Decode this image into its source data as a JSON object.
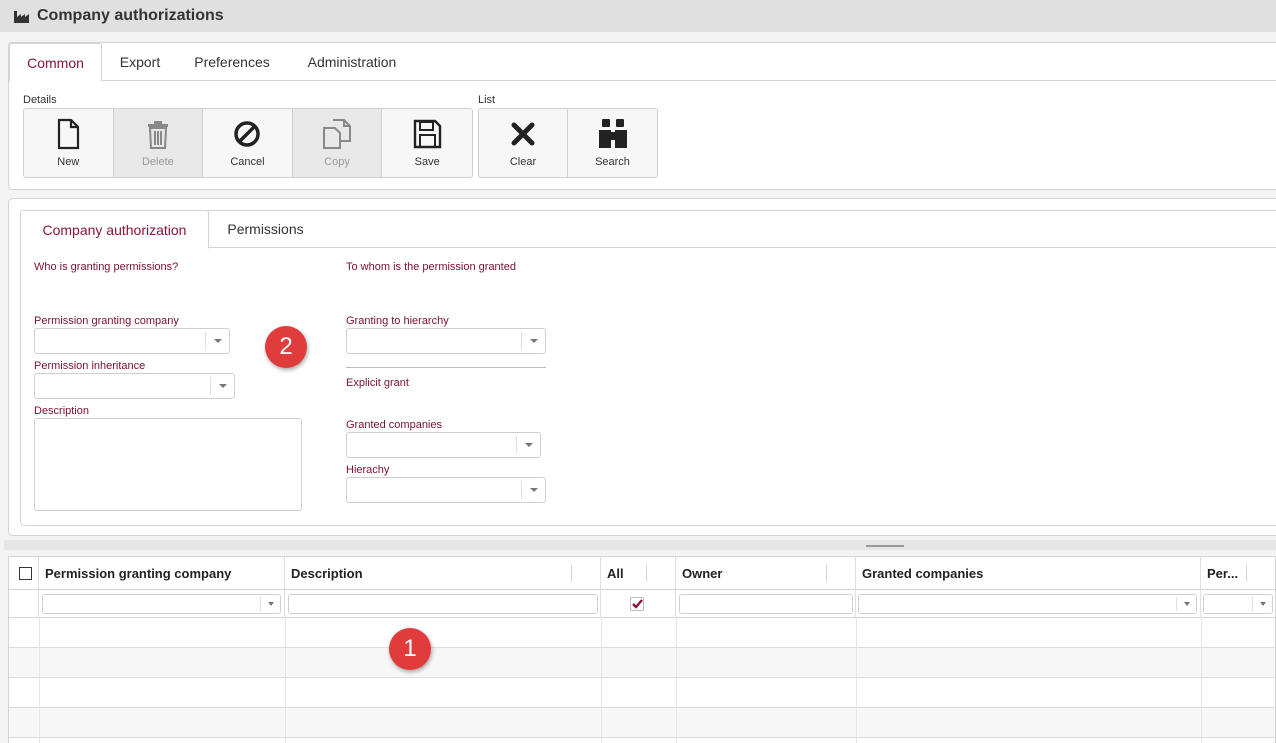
{
  "window": {
    "title": "Company authorizations",
    "icon": "factory-icon"
  },
  "main_tabs": [
    {
      "label": "Common",
      "active": true
    },
    {
      "label": "Export",
      "active": false
    },
    {
      "label": "Preferences",
      "active": false
    },
    {
      "label": "Administration",
      "active": false
    }
  ],
  "toolbar": {
    "details_label": "Details",
    "list_label": "List",
    "new": "New",
    "delete": "Delete",
    "cancel": "Cancel",
    "copy": "Copy",
    "save": "Save",
    "clear": "Clear",
    "search": "Search"
  },
  "form_tabs": [
    {
      "label": "Company authorization",
      "active": true
    },
    {
      "label": "Permissions",
      "active": false
    }
  ],
  "form": {
    "left_heading": "Who is granting permissions?",
    "right_heading": "To whom is the permission granted",
    "granting_company_label": "Permission granting company",
    "inheritance_label": "Permission inheritance",
    "description_label": "Description",
    "granting_hierarchy_label": "Granting to hierarchy",
    "explicit_grant_label": "Explicit grant",
    "granted_companies_label": "Granted companies",
    "hierarchy_label": "Hierachy"
  },
  "badges": {
    "one": "1",
    "two": "2"
  },
  "grid": {
    "columns": {
      "granting_company": "Permission granting company",
      "description": "Description",
      "all": "All",
      "owner": "Owner",
      "granted_companies": "Granted companies",
      "per": "Per..."
    },
    "all_filter_checked": true,
    "rows": 4
  },
  "colors": {
    "accent": "#8a1538",
    "badge": "#e03c3c"
  }
}
